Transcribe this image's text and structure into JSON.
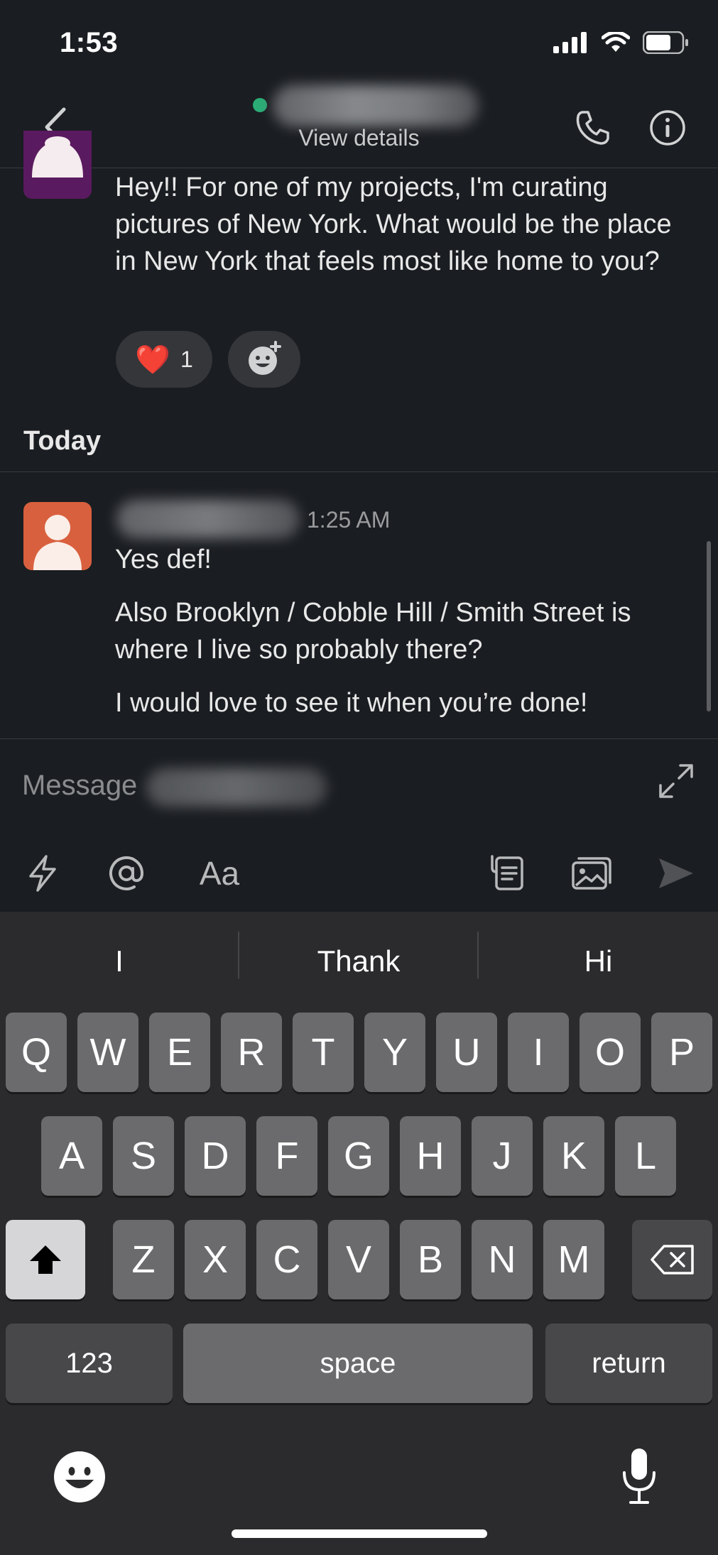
{
  "status_bar": {
    "time": "1:53"
  },
  "header": {
    "subtitle": "View details"
  },
  "messages": {
    "first": {
      "text": "Hey!! For one of my projects, I'm curating pictures of New York. What would be the place in New York that feels most like home to you?",
      "reactions": [
        {
          "emoji": "❤️",
          "count": "1"
        }
      ]
    },
    "day_separator": "Today",
    "second": {
      "time": "1:25 AM",
      "lines": [
        "Yes def!",
        "Also Brooklyn / Cobble Hill / Smith Street is where I live so probably there?",
        "I would love to see it when you’re done!"
      ]
    }
  },
  "composer": {
    "placeholder": "Message",
    "toolbar": {
      "format_label": "Aa"
    }
  },
  "keyboard": {
    "suggestions": [
      "I",
      "Thank",
      "Hi"
    ],
    "row1": [
      "Q",
      "W",
      "E",
      "R",
      "T",
      "Y",
      "U",
      "I",
      "O",
      "P"
    ],
    "row2": [
      "A",
      "S",
      "D",
      "F",
      "G",
      "H",
      "J",
      "K",
      "L"
    ],
    "row3": [
      "Z",
      "X",
      "C",
      "V",
      "B",
      "N",
      "M"
    ],
    "numbers_label": "123",
    "space_label": "space",
    "return_label": "return"
  },
  "colors": {
    "background": "#1a1d21",
    "presence": "#2bac76",
    "avatar_2": "#d9603e",
    "keyboard_bg": "#2b2b2d"
  }
}
